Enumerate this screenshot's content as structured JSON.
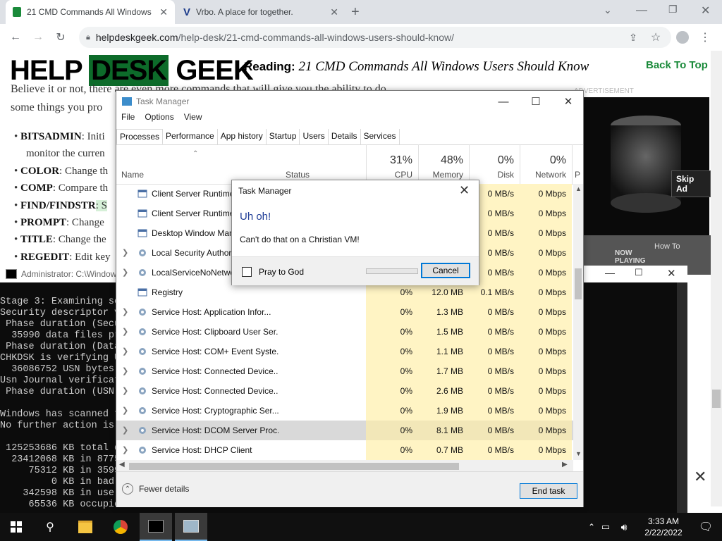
{
  "browser": {
    "tabs": [
      {
        "title": "21 CMD Commands All Windows",
        "active": true
      },
      {
        "title": "Vrbo. A place for together.",
        "active": false
      }
    ],
    "url_domain": "helpdeskgeek.com",
    "url_path": "/help-desk/21-cmd-commands-all-windows-users-should-know/"
  },
  "page": {
    "logo_help": "HELP",
    "logo_desk": "DESK",
    "logo_geek": "GEEK",
    "reading_label": "Reading:",
    "reading_title": "21 CMD Commands All Windows Users Should Know",
    "back_to_top": "Back To Top",
    "intro_line1": "Believe it or not, there are even more commands that will give you the ability to do",
    "intro_line2": "some things you pro",
    "bullets": [
      {
        "cmd": "BITSADMIN",
        "text": ": Initi"
      },
      {
        "cmd": "",
        "text": "monitor the curren"
      },
      {
        "cmd": "COLOR",
        "text": ": Change th"
      },
      {
        "cmd": "COMP",
        "text": ": Compare th"
      },
      {
        "cmd": "FIND/FINDSTR",
        "text": ": S"
      },
      {
        "cmd": "PROMPT",
        "text": ": Change"
      },
      {
        "cmd": "TITLE",
        "text": ": Change the"
      },
      {
        "cmd": "REGEDIT",
        "text": ": Edit key"
      }
    ],
    "ad_label": "ADVERTISEMENT",
    "skip_ad": "Skip Ad",
    "thumb1": "NOW PLAYING",
    "thumb2": "How To"
  },
  "cmd": {
    "title": "Administrator: C:\\Window",
    "lines": [
      "Stage 3: Examining se",
      "Security descriptor v",
      " Phase duration (Secu",
      "  35990 data files pr",
      " Phase duration (Data",
      "CHKDSK is verifying U",
      "  36086752 USN bytes",
      "Usn Journal verificat",
      " Phase duration (USN",
      "",
      "Windows has scanned t",
      "No further action is",
      "",
      " 125253686 KB total d",
      "  23412068 KB in 8775",
      "     75312 KB in 3599",
      "         0 KB in bad",
      "    342598 KB in use",
      "     65536 KB occupie"
    ]
  },
  "task_manager": {
    "title": "Task Manager",
    "menu": [
      "File",
      "Options",
      "View"
    ],
    "tabs": [
      "Processes",
      "Performance",
      "App history",
      "Startup",
      "Users",
      "Details",
      "Services"
    ],
    "columns": {
      "name": "Name",
      "status": "Status",
      "cpu_pct": "31%",
      "cpu": "CPU",
      "mem_pct": "48%",
      "mem": "Memory",
      "disk_pct": "0%",
      "disk": "Disk",
      "net_pct": "0%",
      "net": "Network",
      "power": "P"
    },
    "rows": [
      {
        "name": "Client Server Runtime",
        "cpu": "",
        "mem": "",
        "disk": "0 MB/s",
        "net": "0 Mbps",
        "expand": false
      },
      {
        "name": "Client Server Runtime",
        "cpu": "",
        "mem": "",
        "disk": "0 MB/s",
        "net": "0 Mbps",
        "expand": false
      },
      {
        "name": "Desktop Window Man",
        "cpu": "",
        "mem": "",
        "disk": "0 MB/s",
        "net": "0 Mbps",
        "expand": false
      },
      {
        "name": "Local Security Author",
        "cpu": "",
        "mem": "",
        "disk": "0 MB/s",
        "net": "0 Mbps",
        "expand": true
      },
      {
        "name": "LocalServiceNoNetwo",
        "cpu": "",
        "mem": "",
        "disk": "0 MB/s",
        "net": "0 Mbps",
        "expand": true
      },
      {
        "name": "Registry",
        "cpu": "0%",
        "mem": "12.0 MB",
        "disk": "0.1 MB/s",
        "net": "0 Mbps",
        "expand": false
      },
      {
        "name": "Service Host: Application Infor...",
        "cpu": "0%",
        "mem": "1.3 MB",
        "disk": "0 MB/s",
        "net": "0 Mbps",
        "expand": true
      },
      {
        "name": "Service Host: Clipboard User Ser...",
        "cpu": "0%",
        "mem": "1.5 MB",
        "disk": "0 MB/s",
        "net": "0 Mbps",
        "expand": true
      },
      {
        "name": "Service Host: COM+ Event Syste...",
        "cpu": "0%",
        "mem": "1.1 MB",
        "disk": "0 MB/s",
        "net": "0 Mbps",
        "expand": true
      },
      {
        "name": "Service Host: Connected Device...",
        "cpu": "0%",
        "mem": "1.7 MB",
        "disk": "0 MB/s",
        "net": "0 Mbps",
        "expand": true
      },
      {
        "name": "Service Host: Connected Device...",
        "cpu": "0%",
        "mem": "2.6 MB",
        "disk": "0 MB/s",
        "net": "0 Mbps",
        "expand": true
      },
      {
        "name": "Service Host: Cryptographic Ser...",
        "cpu": "0%",
        "mem": "1.9 MB",
        "disk": "0 MB/s",
        "net": "0 Mbps",
        "expand": true
      },
      {
        "name": "Service Host: DCOM Server Proc...",
        "cpu": "0%",
        "mem": "8.1 MB",
        "disk": "0 MB/s",
        "net": "0 Mbps",
        "expand": true,
        "selected": true
      },
      {
        "name": "Service Host: DHCP Client",
        "cpu": "0%",
        "mem": "0.7 MB",
        "disk": "0 MB/s",
        "net": "0 Mbps",
        "expand": true
      }
    ],
    "fewer_details": "Fewer details",
    "end_task": "End task"
  },
  "dialog": {
    "title": "Task Manager",
    "heading": "Uh oh!",
    "message": "Can't do that on a Christian VM!",
    "checkbox_label": "Pray to God",
    "cancel": "Cancel"
  },
  "taskbar": {
    "time": "3:33 AM",
    "date": "2/22/2022"
  },
  "colors": {
    "cell_highlight": "#fff4c4",
    "dialog_heading": "#1e3c96",
    "accent_blue": "#0078d7"
  }
}
